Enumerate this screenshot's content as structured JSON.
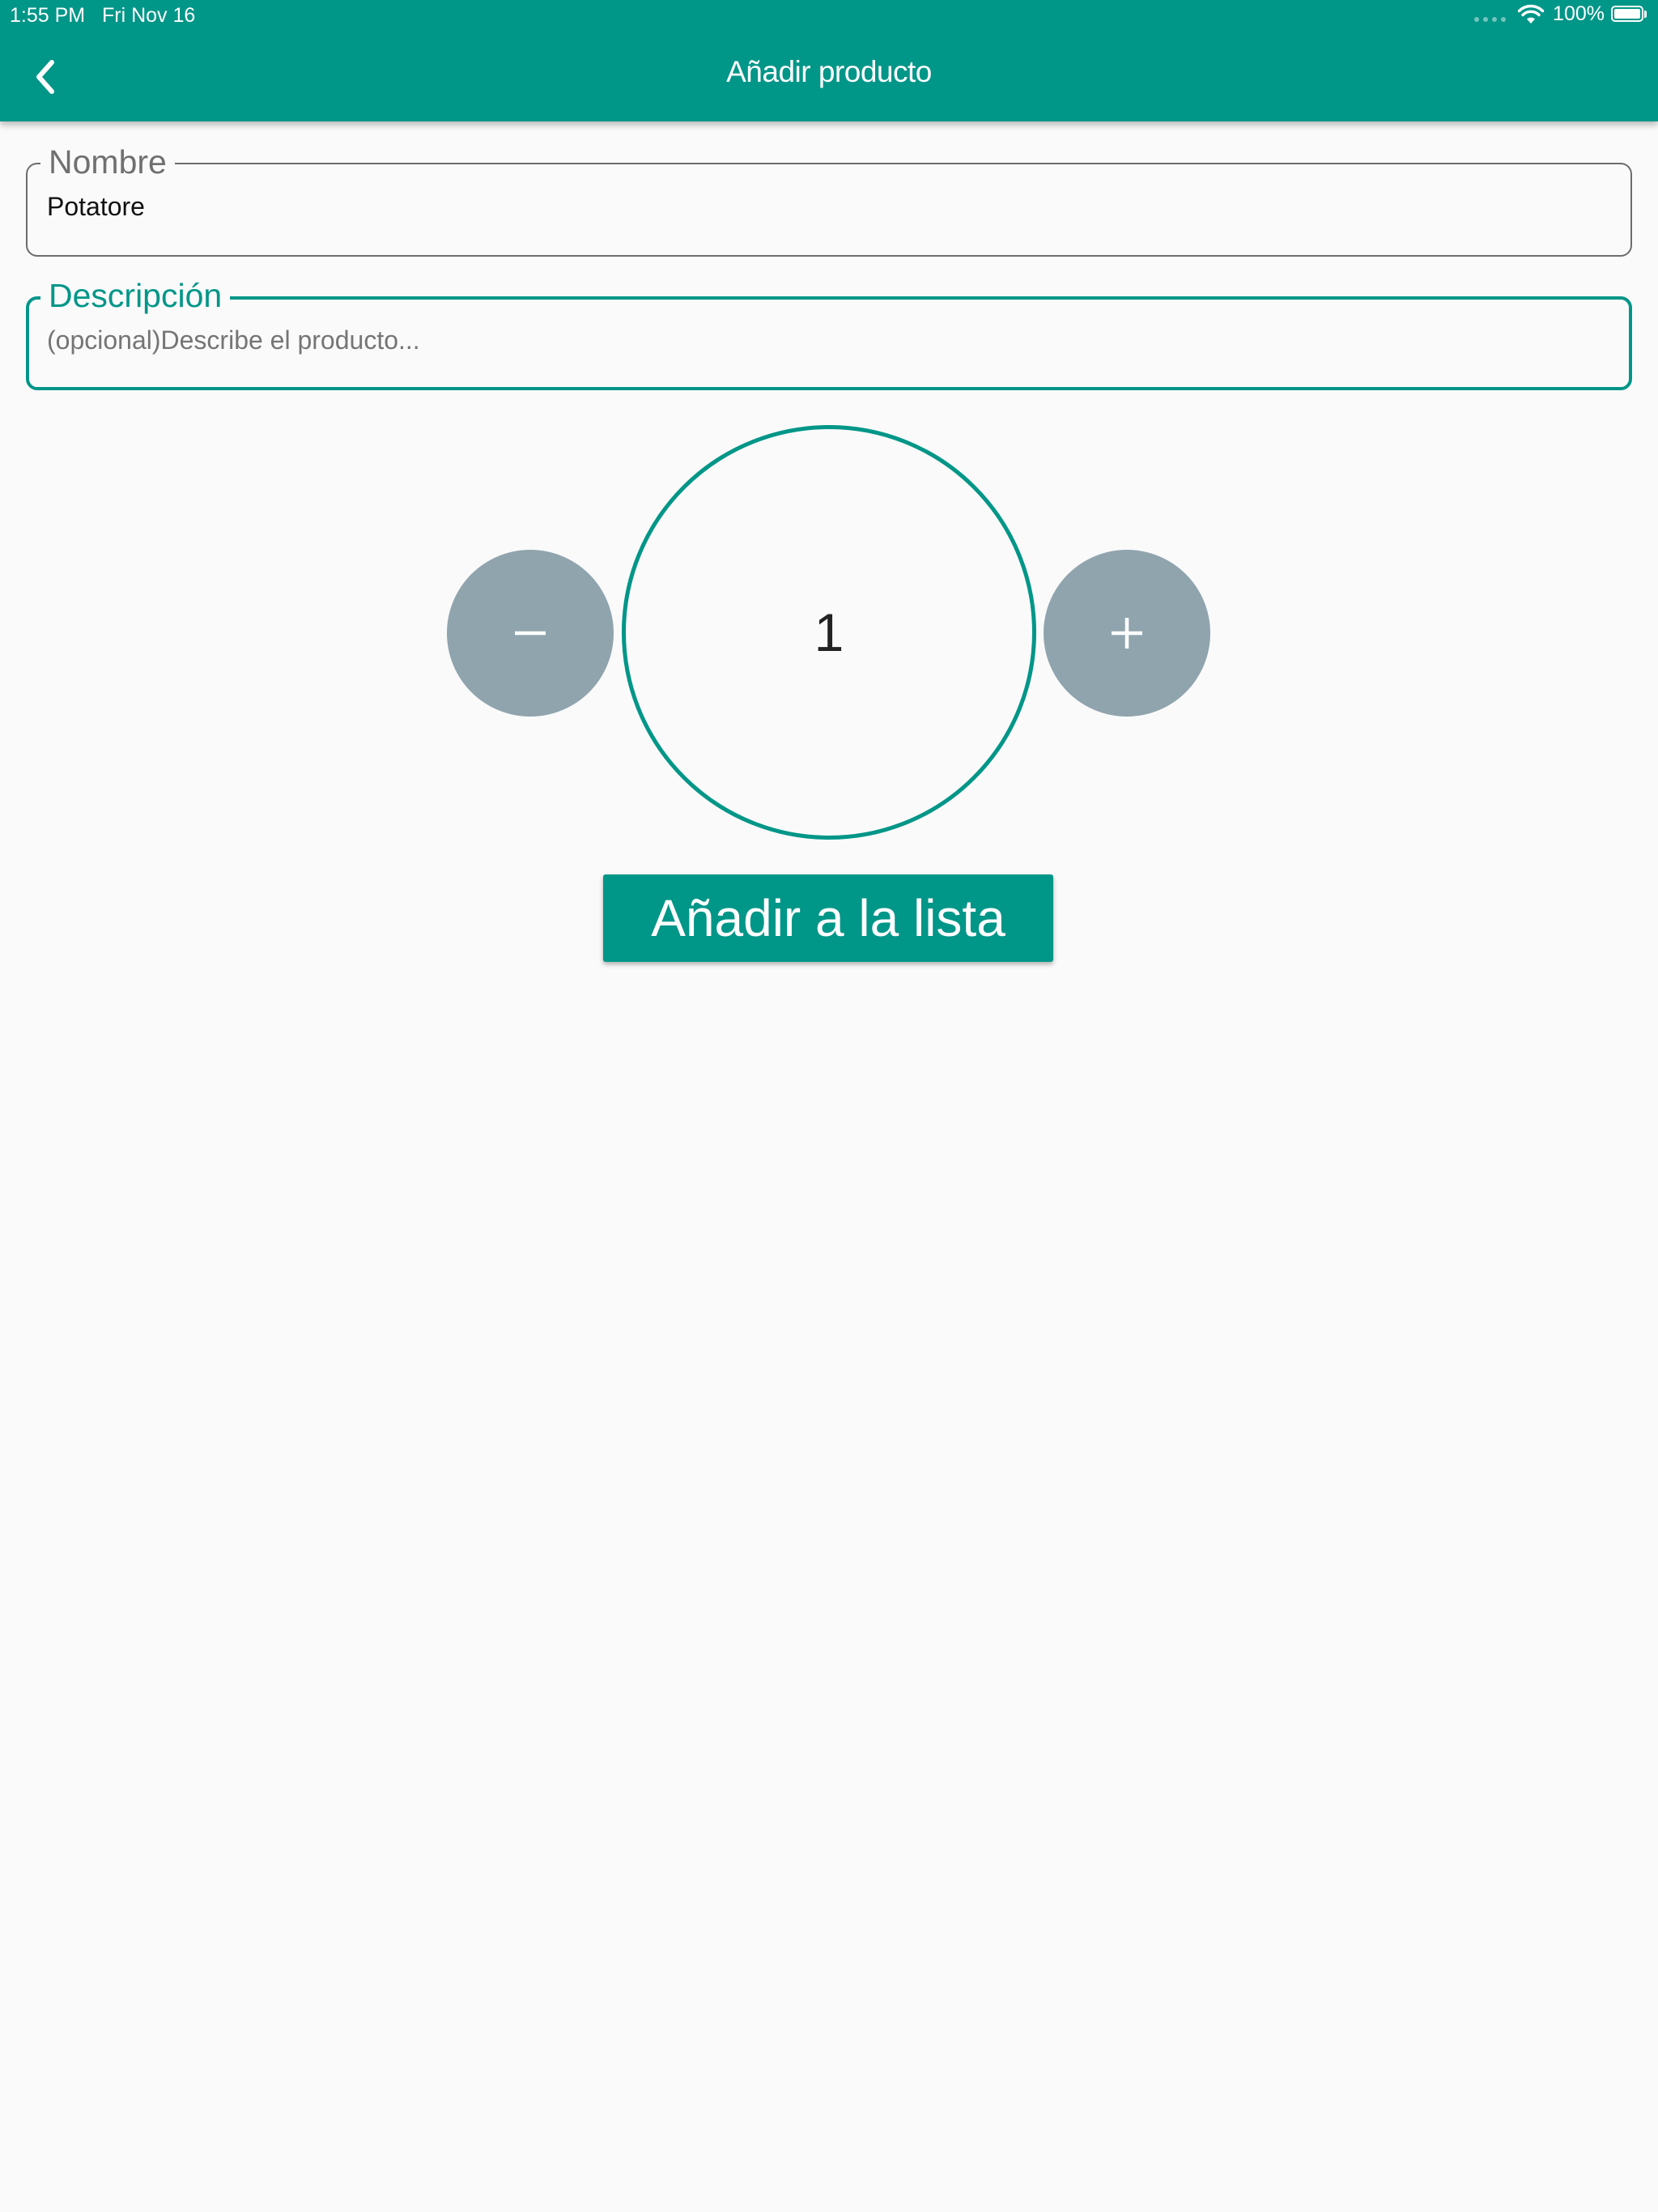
{
  "status_bar": {
    "time": "1:55 PM",
    "date": "Fri Nov 16",
    "battery": "100%",
    "icons": [
      "wifi-icon",
      "battery-icon"
    ]
  },
  "appbar": {
    "title": "Añadir producto",
    "back_icon": "chevron-left-icon"
  },
  "form": {
    "nombre": {
      "label": "Nombre",
      "value": "Potatore"
    },
    "descripcion": {
      "label": "Descripción",
      "value": "",
      "placeholder": "(opcional)Describe el producto..."
    }
  },
  "stepper": {
    "quantity": "1",
    "minus_icon": "minus-icon",
    "plus_icon": "plus-icon"
  },
  "actions": {
    "add_label": "Añadir a la lista"
  },
  "colors": {
    "primary": "#009688",
    "stepper_button": "#90a4ae",
    "background": "#fafafa"
  }
}
